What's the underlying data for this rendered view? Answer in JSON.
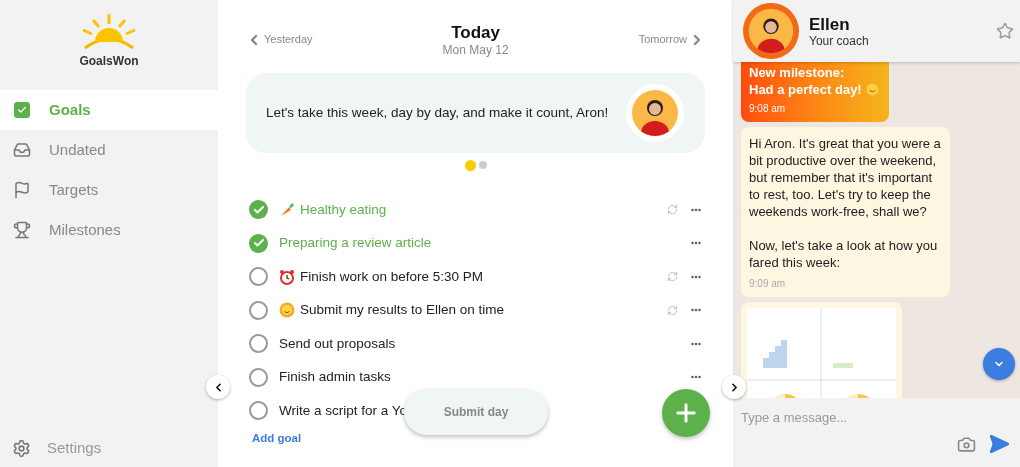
{
  "brand": {
    "name": "GoalsWon"
  },
  "nav": [
    {
      "label": "Goals",
      "selected": true,
      "kind": "goals"
    },
    {
      "label": "Undated",
      "selected": false,
      "kind": "undated"
    },
    {
      "label": "Targets",
      "selected": false,
      "kind": "targets"
    },
    {
      "label": "Milestones",
      "selected": false,
      "kind": "milestones"
    }
  ],
  "settings": {
    "label": "Settings"
  },
  "day_nav": {
    "previous": "Yesterday",
    "title": "Today",
    "date": "Mon May 12",
    "next": "Tomorrow"
  },
  "quote": {
    "text": "Let's take this week, day by day, and make it count, Aron!"
  },
  "carousel": [
    {
      "selected": true
    },
    {
      "selected": false
    }
  ],
  "goals": [
    {
      "label": "Healthy eating",
      "checked": true,
      "kind": "food",
      "repeating": true
    },
    {
      "label": "Preparing a review article",
      "checked": true,
      "repeating": false
    },
    {
      "label": "Finish work on before 5:30 PM",
      "checked": false,
      "kind": "timed",
      "repeating": true
    },
    {
      "label": "Submit my results to Ellen on time",
      "checked": false,
      "kind": "report",
      "repeating": true
    },
    {
      "label": "Send out proposals",
      "checked": false,
      "repeating": false
    },
    {
      "label": "Finish admin tasks",
      "checked": false,
      "repeating": false
    },
    {
      "label": "Write a script for a Yo",
      "checked": false
    }
  ],
  "add_goal": "Add goal",
  "submit_day": "Submit day",
  "coach": {
    "name": "Ellen",
    "role": "Your coach"
  },
  "messages": [
    {
      "kind": "milestone",
      "lines": [
        "New milestone:",
        "Had a perfect day!"
      ],
      "time": "9:08 am"
    },
    {
      "kind": "text",
      "paragraphs": [
        "Hi Aron. It's great that you were a bit productive over the weekend, but remember that it's important to rest, too. Let's try to keep the weekends work-free, shall we?",
        "Now, let's take a look at how you fared this week:"
      ],
      "time": "9:09 am"
    },
    {
      "kind": "image"
    }
  ],
  "composer": {
    "placeholder": "Type a message..."
  }
}
